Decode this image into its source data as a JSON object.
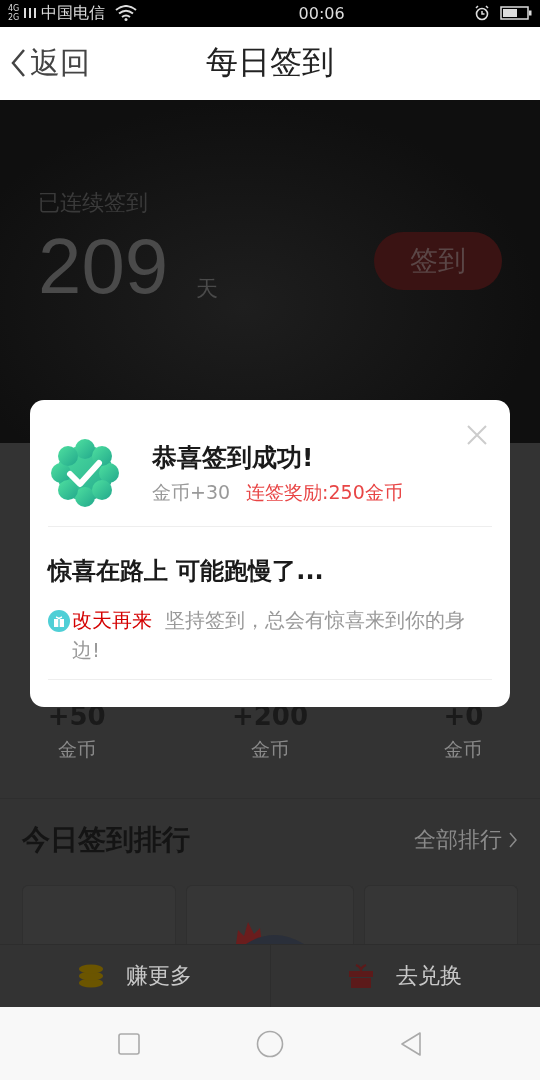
{
  "status_bar": {
    "network": [
      "4G",
      "2G"
    ],
    "carrier": "中国电信",
    "time": "00:06"
  },
  "nav": {
    "back": "返回",
    "title": "每日签到"
  },
  "hero": {
    "label": "已连续签到",
    "count": "209",
    "unit": "天",
    "button": "签到"
  },
  "rewards": [
    {
      "amount": "+50",
      "unit": "金币"
    },
    {
      "amount": "+200",
      "unit": "金币"
    },
    {
      "amount": "+0",
      "unit": "金币"
    }
  ],
  "ranking": {
    "title": "今日签到排行",
    "link": "全部排行"
  },
  "bottom_actions": [
    {
      "label": "赚更多",
      "kind": "coins"
    },
    {
      "label": "去兑换",
      "kind": "gift"
    }
  ],
  "dialog": {
    "title": "恭喜签到成功!",
    "coins": "金币+30",
    "bonus": "连签奖励:250金币",
    "subtitle": "惊喜在路上 可能跑慢了...",
    "tag": "改天再来",
    "message": "坚持签到，总会有惊喜来到你的身边!"
  }
}
